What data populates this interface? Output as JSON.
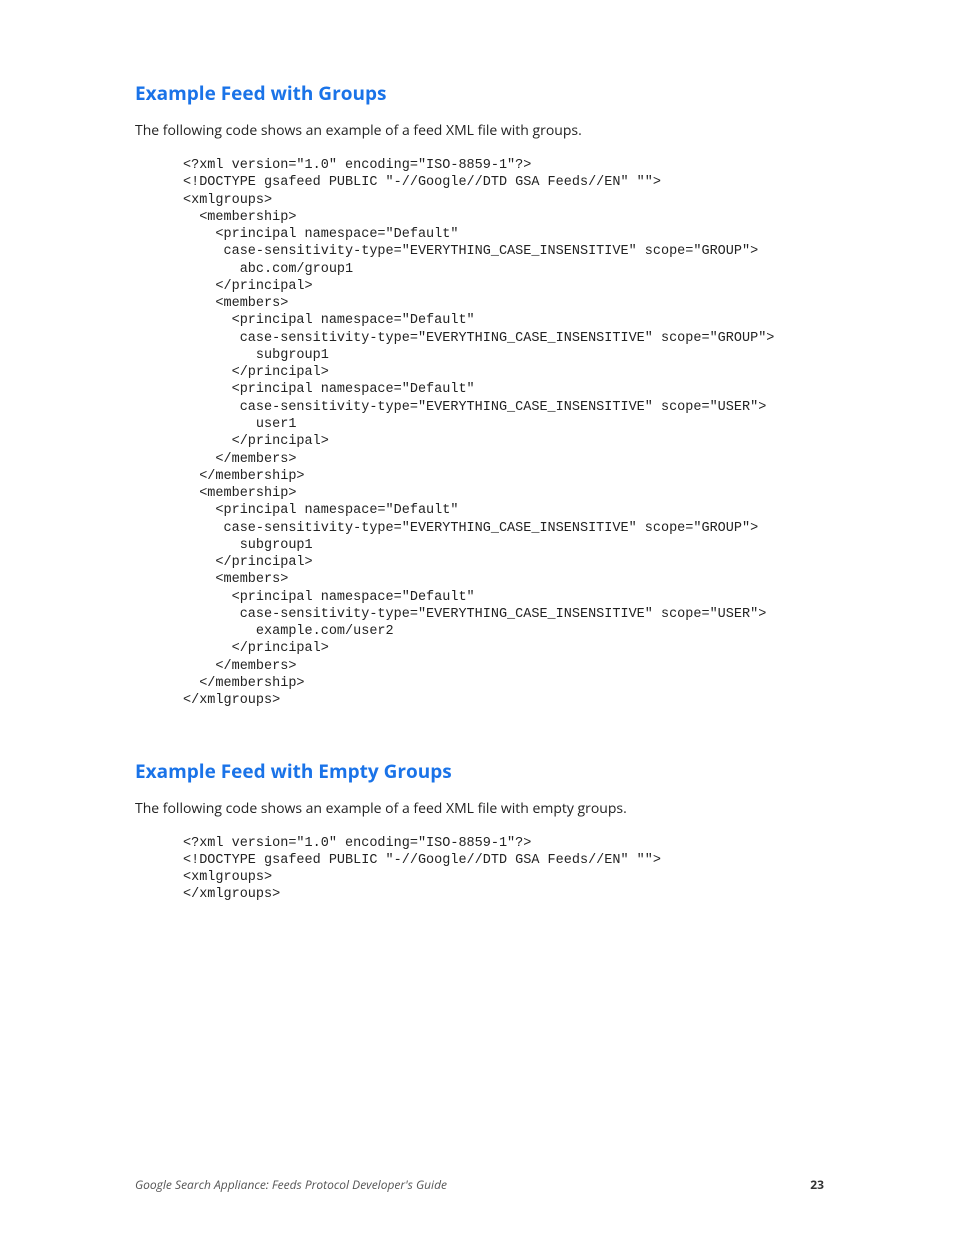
{
  "section1": {
    "heading": "Example Feed with Groups",
    "intro": "The following code shows an example of a feed XML file with groups.",
    "code": "<?xml version=\"1.0\" encoding=\"ISO-8859-1\"?>\n<!DOCTYPE gsafeed PUBLIC \"-//Google//DTD GSA Feeds//EN\" \"\">\n<xmlgroups>\n  <membership>\n    <principal namespace=\"Default\"\n     case-sensitivity-type=\"EVERYTHING_CASE_INSENSITIVE\" scope=\"GROUP\">\n       abc.com/group1\n    </principal>\n    <members>\n      <principal namespace=\"Default\"\n       case-sensitivity-type=\"EVERYTHING_CASE_INSENSITIVE\" scope=\"GROUP\">\n         subgroup1\n      </principal>\n      <principal namespace=\"Default\"\n       case-sensitivity-type=\"EVERYTHING_CASE_INSENSITIVE\" scope=\"USER\">\n         user1\n      </principal>\n    </members>\n  </membership>\n  <membership>\n    <principal namespace=\"Default\"\n     case-sensitivity-type=\"EVERYTHING_CASE_INSENSITIVE\" scope=\"GROUP\">\n       subgroup1\n    </principal>\n    <members>\n      <principal namespace=\"Default\"\n       case-sensitivity-type=\"EVERYTHING_CASE_INSENSITIVE\" scope=\"USER\">\n         example.com/user2\n      </principal>\n    </members>\n  </membership>\n</xmlgroups>"
  },
  "section2": {
    "heading": "Example Feed with Empty Groups",
    "intro": "The following code shows an example of a feed XML file with empty groups.",
    "code": "<?xml version=\"1.0\" encoding=\"ISO-8859-1\"?>\n<!DOCTYPE gsafeed PUBLIC \"-//Google//DTD GSA Feeds//EN\" \"\">\n<xmlgroups>\n</xmlgroups>"
  },
  "footer": {
    "title": "Google Search Appliance: Feeds Protocol Developer's Guide",
    "page": "23"
  }
}
